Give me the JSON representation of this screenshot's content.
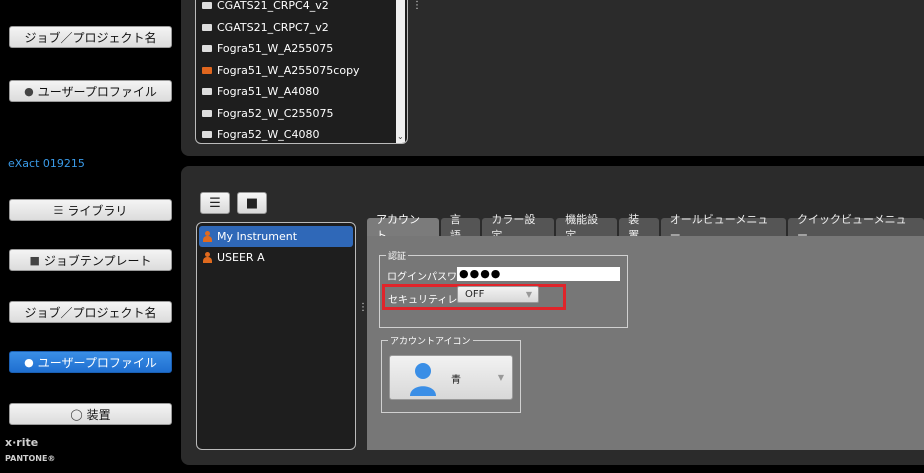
{
  "sidebar": {
    "device_name": "eXact 019215",
    "buttons_top": [
      {
        "label": "ジョブ／プロジェクト名",
        "icon": ""
      },
      {
        "label": "ユーザープロファイル",
        "icon": "user-icon"
      }
    ],
    "buttons": [
      {
        "label": "ライブラリ",
        "icon": "library-icon"
      },
      {
        "label": "ジョブテンプレート",
        "icon": "folder-icon"
      },
      {
        "label": "ジョブ／プロジェクト名",
        "icon": ""
      },
      {
        "label": "ユーザープロファイル",
        "icon": "user-icon",
        "active": true
      },
      {
        "label": "装置",
        "icon": "device-icon"
      }
    ],
    "brand_logo": "x·rite",
    "brand_sub": "PANTONE®"
  },
  "file_list": {
    "items": [
      {
        "name": "CGATS21_CRPC4_v2",
        "color": "#dddddd"
      },
      {
        "name": "CGATS21_CRPC7_v2",
        "color": "#dddddd"
      },
      {
        "name": "Fogra51_W_A255075",
        "color": "#dddddd"
      },
      {
        "name": "Fogra51_W_A255075copy",
        "color": "#e0661e"
      },
      {
        "name": "Fogra51_W_A4080",
        "color": "#dddddd"
      },
      {
        "name": "Fogra52_W_C255075",
        "color": "#dddddd"
      },
      {
        "name": "Fogra52_W_C4080",
        "color": "#dddddd"
      }
    ]
  },
  "instruments": {
    "items": [
      {
        "name": "My Instrument",
        "selected": true
      },
      {
        "name": "USEER A",
        "selected": false
      }
    ]
  },
  "tabs": [
    "アカウント",
    "言語",
    "カラー設定",
    "機能設定",
    "装置",
    "オールビューメニュー",
    "クイックビューメニュー"
  ],
  "account": {
    "auth_group_title": "認証",
    "login_password_label": "ログインパスワード",
    "login_password_value": "●●●●",
    "security_level_label": "セキュリティレベル",
    "security_level_value": "OFF",
    "icon_group_title": "アカウントアイコン",
    "icon_color_value": "青"
  },
  "colors": {
    "accent": "#2f68b8",
    "highlight": "#e0242a",
    "panel": "#2b2b2b",
    "content": "#777777"
  }
}
